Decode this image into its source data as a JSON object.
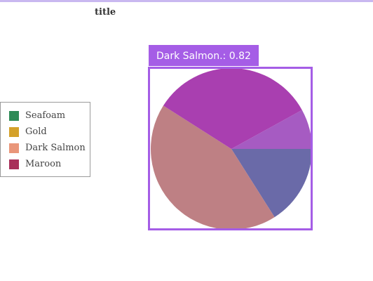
{
  "chart_data": {
    "type": "pie",
    "title": "title",
    "categories": [
      "Seafoam",
      "Gold",
      "Dark Salmon",
      "Maroon"
    ],
    "values": [
      0.16,
      0.0,
      0.43,
      0.41
    ],
    "slices": [
      {
        "label": "Seafoam",
        "value": 0.16,
        "color": "#6a6aa8"
      },
      {
        "label": "Gold",
        "value": 0.0,
        "color": "#b08050"
      },
      {
        "label": "Dark Salmon",
        "value": 0.43,
        "color": "#be8084"
      },
      {
        "label": "Maroon",
        "value": 0.33,
        "color": "#a93fb0"
      },
      {
        "label": "Maroon",
        "value": 0.08,
        "color": "#a65bc2"
      }
    ],
    "legend": {
      "position": "left",
      "items": [
        {
          "label": "Seafoam",
          "color": "#2e8b57"
        },
        {
          "label": "Gold",
          "color": "#d4a12a"
        },
        {
          "label": "Dark Salmon",
          "color": "#e9967a"
        },
        {
          "label": "Maroon",
          "color": "#a8305a"
        }
      ]
    },
    "annotation": {
      "text": "Dark Salmon.: 0.82",
      "color": "#a55de6"
    }
  }
}
